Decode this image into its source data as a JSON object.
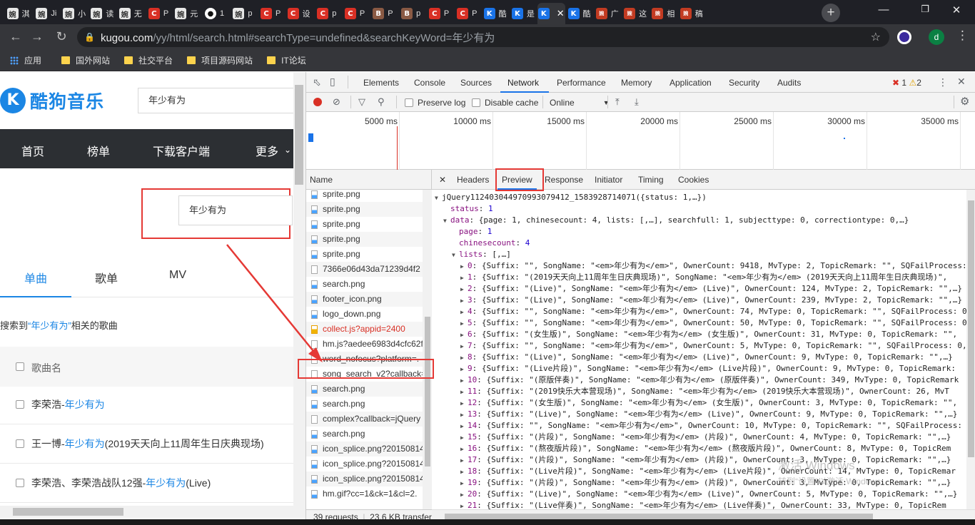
{
  "browser": {
    "tabs": [
      {
        "icon": "gray",
        "glyph": "婉",
        "label": "淇"
      },
      {
        "icon": "gray",
        "glyph": "婉",
        "label": "Ji"
      },
      {
        "icon": "gray",
        "glyph": "婉",
        "label": "小"
      },
      {
        "icon": "gray",
        "glyph": "婉",
        "label": "读"
      },
      {
        "icon": "gray",
        "glyph": "婉",
        "label": "无"
      },
      {
        "icon": "red",
        "glyph": "C",
        "label": "P"
      },
      {
        "icon": "gray",
        "glyph": "婉",
        "label": "元"
      },
      {
        "icon": "gh",
        "glyph": "●",
        "label": "1"
      },
      {
        "icon": "gray",
        "glyph": "婉",
        "label": "p"
      },
      {
        "icon": "red",
        "glyph": "C",
        "label": "P"
      },
      {
        "icon": "red",
        "glyph": "C",
        "label": "设"
      },
      {
        "icon": "red",
        "glyph": "C",
        "label": "p"
      },
      {
        "icon": "red",
        "glyph": "C",
        "label": "P"
      },
      {
        "icon": "brown",
        "glyph": "B",
        "label": "P"
      },
      {
        "icon": "brown",
        "glyph": "B",
        "label": "p"
      },
      {
        "icon": "red",
        "glyph": "C",
        "label": "P"
      },
      {
        "icon": "red",
        "glyph": "C",
        "label": "P"
      },
      {
        "icon": "blue",
        "glyph": "K",
        "label": "酷"
      },
      {
        "icon": "blue",
        "glyph": "K",
        "label": "是"
      },
      {
        "icon": "blue",
        "glyph": "K",
        "label": ""
      },
      {
        "icon": "blue",
        "glyph": "K",
        "label": "酷"
      },
      {
        "icon": "multi",
        "glyph": "婉",
        "label": "广"
      },
      {
        "icon": "multi",
        "glyph": "婉",
        "label": "这"
      },
      {
        "icon": "multi",
        "glyph": "婉",
        "label": "相"
      },
      {
        "icon": "multi",
        "glyph": "婉",
        "label": "稿"
      }
    ],
    "url_host": "kugou.com",
    "url_path": "/yy/html/search.html#searchType=undefined&searchKeyWord=年少有为",
    "avatar_letter": "d",
    "bookmarks": [
      "应用",
      "国外网站",
      "社交平台",
      "项目源码网站",
      "IT论坛"
    ]
  },
  "page": {
    "logo_mark": "K",
    "logo_text": "酷狗音乐",
    "top_search_value": "年少有为",
    "nav": [
      "首页",
      "榜单",
      "下载客户端",
      "更多"
    ],
    "hero_search_value": "年少有为",
    "tabs": [
      "单曲",
      "歌单",
      "MV"
    ],
    "result_prefix": "搜索到",
    "result_keyword": "“年少有为”",
    "result_suffix": "相关的歌曲",
    "song_header": "歌曲名",
    "songs": [
      {
        "singer": "李荣浩",
        "sep": " - ",
        "title": "年少有为",
        "extra": ""
      },
      {
        "singer": "王一博",
        "sep": " - ",
        "title": "年少有为",
        "extra": " (2019天天向上11周年生日庆典现场)"
      },
      {
        "singer": "李荣浩、李荣浩战队12强",
        "sep": " - ",
        "title": "年少有为",
        "extra": " (Live)"
      }
    ]
  },
  "devtools": {
    "tabs": [
      "Elements",
      "Console",
      "Sources",
      "Network",
      "Performance",
      "Memory",
      "Application",
      "Security",
      "Audits"
    ],
    "active_tab": "Network",
    "error_count": "1",
    "warning_count": "2",
    "toolbar": {
      "preserve_log": "Preserve log",
      "disable_cache": "Disable cache",
      "throttle": "Online"
    },
    "overview_labels": [
      "5000 ms",
      "10000 ms",
      "15000 ms",
      "20000 ms",
      "25000 ms",
      "30000 ms",
      "35000 ms"
    ],
    "name_header": "Name",
    "requests": [
      {
        "name": "sprite.png",
        "type": "img",
        "error": false
      },
      {
        "name": "sprite.png",
        "type": "img",
        "error": false
      },
      {
        "name": "sprite.png",
        "type": "img",
        "error": false
      },
      {
        "name": "sprite.png",
        "type": "img",
        "error": false
      },
      {
        "name": "sprite.png",
        "type": "img",
        "error": false
      },
      {
        "name": "7366e06d43da71239d4f2",
        "type": "doc",
        "error": false
      },
      {
        "name": "search.png",
        "type": "img",
        "error": false
      },
      {
        "name": "footer_icon.png",
        "type": "img",
        "error": false
      },
      {
        "name": "logo_down.png",
        "type": "img",
        "error": false
      },
      {
        "name": "collect.js?appid=2400",
        "type": "js",
        "error": true
      },
      {
        "name": "hm.js?aedee6983d4cfc62f",
        "type": "doc",
        "error": false
      },
      {
        "name": "word_nofocus?platform=.",
        "type": "doc",
        "error": false
      },
      {
        "name": "song_search_v2?callback=",
        "type": "doc",
        "error": false
      },
      {
        "name": "search.png",
        "type": "img",
        "error": false
      },
      {
        "name": "search.png",
        "type": "img",
        "error": false
      },
      {
        "name": "complex?callback=jQuery",
        "type": "doc",
        "error": false
      },
      {
        "name": "search.png",
        "type": "img",
        "error": false
      },
      {
        "name": "icon_splice.png?20150814",
        "type": "img",
        "error": false
      },
      {
        "name": "icon_splice.png?20150814",
        "type": "img",
        "error": false
      },
      {
        "name": "icon_splice.png?20150814",
        "type": "img",
        "error": false
      },
      {
        "name": "hm.gif?cc=1&ck=1&cl=2.",
        "type": "img",
        "error": false
      }
    ],
    "status": {
      "requests": "39 requests",
      "transfer": "23.6 KB transfer"
    },
    "detail_tabs": [
      "Headers",
      "Preview",
      "Response",
      "Initiator",
      "Timing",
      "Cookies"
    ],
    "active_detail_tab": "Preview",
    "preview_lines": [
      {
        "indent": 0,
        "tri": "▼",
        "text": "jQuery112403044970993079412_1583928714071({status: 1,…})"
      },
      {
        "indent": 1,
        "tri": "",
        "key": "status",
        "text": "1"
      },
      {
        "indent": 1,
        "tri": "▼",
        "key": "data",
        "text": "{page: 1, chinesecount: 4, lists: [,…], searchfull: 1, subjecttype: 0, correctiontype: 0,…}"
      },
      {
        "indent": 2,
        "tri": "",
        "key": "page",
        "text": "1"
      },
      {
        "indent": 2,
        "tri": "",
        "key": "chinesecount",
        "text": "4"
      },
      {
        "indent": 2,
        "tri": "▼",
        "key": "lists",
        "text": "[,…]"
      },
      {
        "indent": 3,
        "tri": "▶",
        "key": "0",
        "text": "{Suffix: \"\", SongName: \"<em>年少有为</em>\", OwnerCount: 9418, MvType: 2, TopicRemark: \"\", SQFailProcess: 0,"
      },
      {
        "indent": 3,
        "tri": "▶",
        "key": "1",
        "text": "{Suffix: \"(2019天天向上11周年生日庆典现场)\", SongName: \"<em>年少有为</em> (2019天天向上11周年生日庆典现场)\","
      },
      {
        "indent": 3,
        "tri": "▶",
        "key": "2",
        "text": "{Suffix: \"(Live)\", SongName: \"<em>年少有为</em> (Live)\", OwnerCount: 124, MvType: 2, TopicRemark: \"\",…}"
      },
      {
        "indent": 3,
        "tri": "▶",
        "key": "3",
        "text": "{Suffix: \"(Live)\", SongName: \"<em>年少有为</em> (Live)\", OwnerCount: 239, MvType: 2, TopicRemark: \"\",…}"
      },
      {
        "indent": 3,
        "tri": "▶",
        "key": "4",
        "text": "{Suffix: \"\", SongName: \"<em>年少有为</em>\", OwnerCount: 74, MvType: 0, TopicRemark: \"\", SQFailProcess: 0,"
      },
      {
        "indent": 3,
        "tri": "▶",
        "key": "5",
        "text": "{Suffix: \"\", SongName: \"<em>年少有为</em>\", OwnerCount: 50, MvType: 0, TopicRemark: \"\", SQFailProcess: 0,"
      },
      {
        "indent": 3,
        "tri": "▶",
        "key": "6",
        "text": "{Suffix: \"(女生版)\", SongName: \"<em>年少有为</em> (女生版)\", OwnerCount: 31, MvType: 0, TopicRemark: \"\","
      },
      {
        "indent": 3,
        "tri": "▶",
        "key": "7",
        "text": "{Suffix: \"\", SongName: \"<em>年少有为</em>\", OwnerCount: 5, MvType: 0, TopicRemark: \"\", SQFailProcess: 0,"
      },
      {
        "indent": 3,
        "tri": "▶",
        "key": "8",
        "text": "{Suffix: \"(Live)\", SongName: \"<em>年少有为</em> (Live)\", OwnerCount: 9, MvType: 0, TopicRemark: \"\",…}"
      },
      {
        "indent": 3,
        "tri": "▶",
        "key": "9",
        "text": "{Suffix: \"(Live片段)\", SongName: \"<em>年少有为</em> (Live片段)\", OwnerCount: 9, MvType: 0, TopicRemark:"
      },
      {
        "indent": 3,
        "tri": "▶",
        "key": "10",
        "text": "{Suffix: \"(原版伴奏)\", SongName: \"<em>年少有为</em> (原版伴奏)\", OwnerCount: 349, MvType: 0, TopicRemark"
      },
      {
        "indent": 3,
        "tri": "▶",
        "key": "11",
        "text": "{Suffix: \"(2019快乐大本营现场)\", SongName: \"<em>年少有为</em> (2019快乐大本营现场)\", OwnerCount: 26, MvT"
      },
      {
        "indent": 3,
        "tri": "▶",
        "key": "12",
        "text": "{Suffix: \"(女生版)\", SongName: \"<em>年少有为</em> (女生版)\", OwnerCount: 3, MvType: 0, TopicRemark: \"\","
      },
      {
        "indent": 3,
        "tri": "▶",
        "key": "13",
        "text": "{Suffix: \"(Live)\", SongName: \"<em>年少有为</em> (Live)\", OwnerCount: 9, MvType: 0, TopicRemark: \"\",…}"
      },
      {
        "indent": 3,
        "tri": "▶",
        "key": "14",
        "text": "{Suffix: \"\", SongName: \"<em>年少有为</em>\", OwnerCount: 10, MvType: 0, TopicRemark: \"\", SQFailProcess: 0,"
      },
      {
        "indent": 3,
        "tri": "▶",
        "key": "15",
        "text": "{Suffix: \"(片段)\", SongName: \"<em>年少有为</em> (片段)\", OwnerCount: 4, MvType: 0, TopicRemark: \"\",…}"
      },
      {
        "indent": 3,
        "tri": "▶",
        "key": "16",
        "text": "{Suffix: \"(熬夜版片段)\", SongName: \"<em>年少有为</em> (熬夜版片段)\", OwnerCount: 8, MvType: 0, TopicRem"
      },
      {
        "indent": 3,
        "tri": "▶",
        "key": "17",
        "text": "{Suffix: \"(片段)\", SongName: \"<em>年少有为</em> (片段)\", OwnerCount: 3, MvType: 0, TopicRemark: \"\",…}"
      },
      {
        "indent": 3,
        "tri": "▶",
        "key": "18",
        "text": "{Suffix: \"(Live片段)\", SongName: \"<em>年少有为</em> (Live片段)\", OwnerCount: 14, MvType: 0, TopicRemar"
      },
      {
        "indent": 3,
        "tri": "▶",
        "key": "19",
        "text": "{Suffix: \"(片段)\", SongName: \"<em>年少有为</em> (片段)\", OwnerCount: 3, MvType: 0, TopicRemark: \"\",…}"
      },
      {
        "indent": 3,
        "tri": "▶",
        "key": "20",
        "text": "{Suffix: \"(Live)\", SongName: \"<em>年少有为</em> (Live)\", OwnerCount: 5, MvType: 0, TopicRemark: \"\",…}"
      },
      {
        "indent": 3,
        "tri": "▶",
        "key": "21",
        "text": "{Suffix: \"(Live伴奏)\", SongName: \"<em>年少有为</em> (Live伴奏)\", OwnerCount: 33, MvType: 0, TopicRem"
      }
    ],
    "watermark_line1": "激活 Windows",
    "watermark_line2": "转到“设置”以激活 Windows。"
  },
  "colors": {
    "accent": "#1b86e4",
    "highlight_box": "#e53935",
    "devtools_blue": "#1a73e8"
  }
}
